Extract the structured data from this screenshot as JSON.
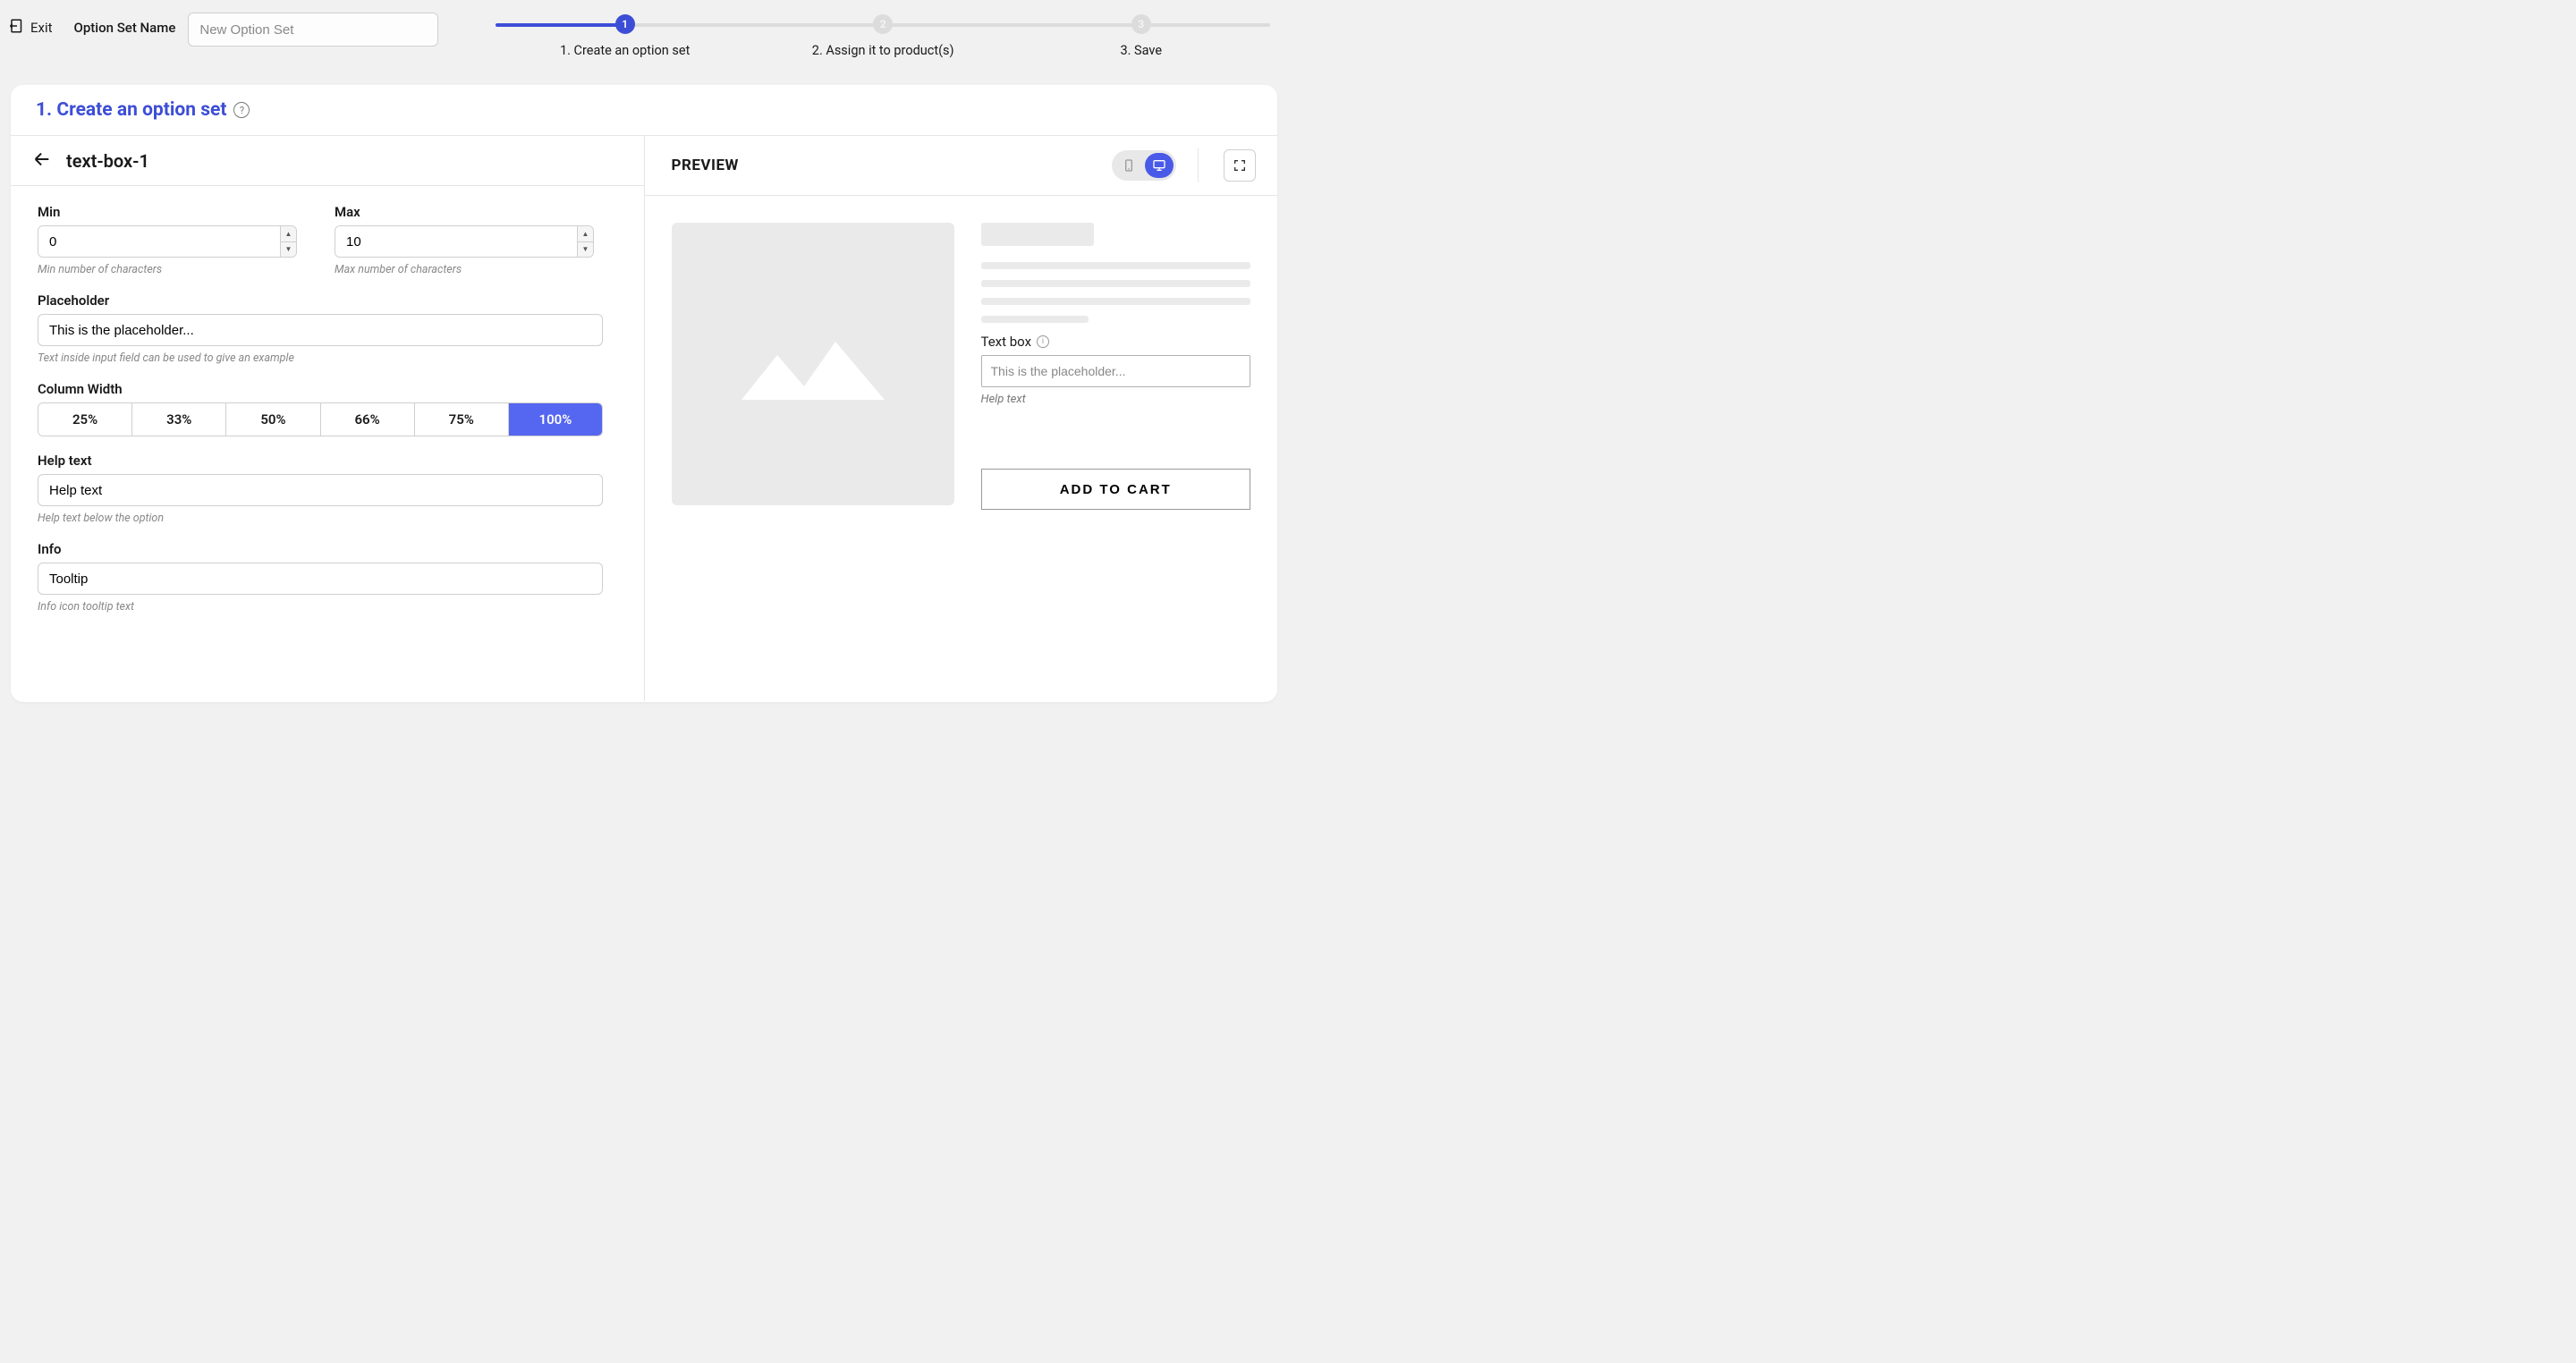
{
  "topbar": {
    "exit_label": "Exit",
    "option_set_name_label": "Option Set Name",
    "option_set_name_placeholder": "New Option Set"
  },
  "stepper": {
    "steps": [
      {
        "num": "1",
        "label": "1. Create an option set",
        "active": true
      },
      {
        "num": "2",
        "label": "2. Assign it to product(s)",
        "active": false
      },
      {
        "num": "3",
        "label": "3. Save",
        "active": false
      }
    ]
  },
  "card": {
    "title": "1. Create an option set",
    "help": "?"
  },
  "editor": {
    "field_name": "text-box-1",
    "min_label": "Min",
    "min_value": "0",
    "min_hint": "Min number of characters",
    "max_label": "Max",
    "max_value": "10",
    "max_hint": "Max number of characters",
    "placeholder_label": "Placeholder",
    "placeholder_value": "This is the placeholder...",
    "placeholder_hint": "Text inside input field can be used to give an example",
    "colwidth_label": "Column Width",
    "colwidth_options": [
      "25%",
      "33%",
      "50%",
      "66%",
      "75%",
      "100%"
    ],
    "colwidth_selected": "100%",
    "help_label": "Help text",
    "help_value": "Help text",
    "help_hint": "Help text below the option",
    "info_label": "Info",
    "info_value": "Tooltip",
    "info_hint": "Info icon tooltip text"
  },
  "preview": {
    "title": "PREVIEW",
    "option_label": "Text box",
    "input_placeholder": "This is the placeholder...",
    "help_text": "Help text",
    "add_to_cart": "ADD TO CART",
    "info_glyph": "i"
  }
}
